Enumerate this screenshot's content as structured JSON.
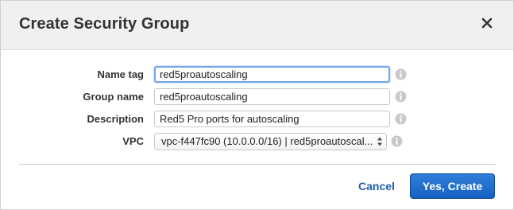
{
  "dialog": {
    "title": "Create Security Group",
    "close_glyph": "✕",
    "close_icon": "close-icon"
  },
  "form": {
    "name_tag": {
      "label": "Name tag",
      "value": "red5proautoscaling"
    },
    "group_name": {
      "label": "Group name",
      "value": "red5proautoscaling"
    },
    "description": {
      "label": "Description",
      "value": "Red5 Pro ports for autoscaling"
    },
    "vpc": {
      "label": "VPC",
      "selected": "vpc-f447fc90 (10.0.0.0/16) | red5proautoscal..."
    },
    "info_icon": "info-icon"
  },
  "footer": {
    "cancel_label": "Cancel",
    "primary_label": "Yes, Create"
  },
  "colors": {
    "primary_button": "#1f6fd0",
    "link": "#1f5ea8",
    "header_bg": "#f0f0f0",
    "focus_ring": "#6fa6e8"
  }
}
